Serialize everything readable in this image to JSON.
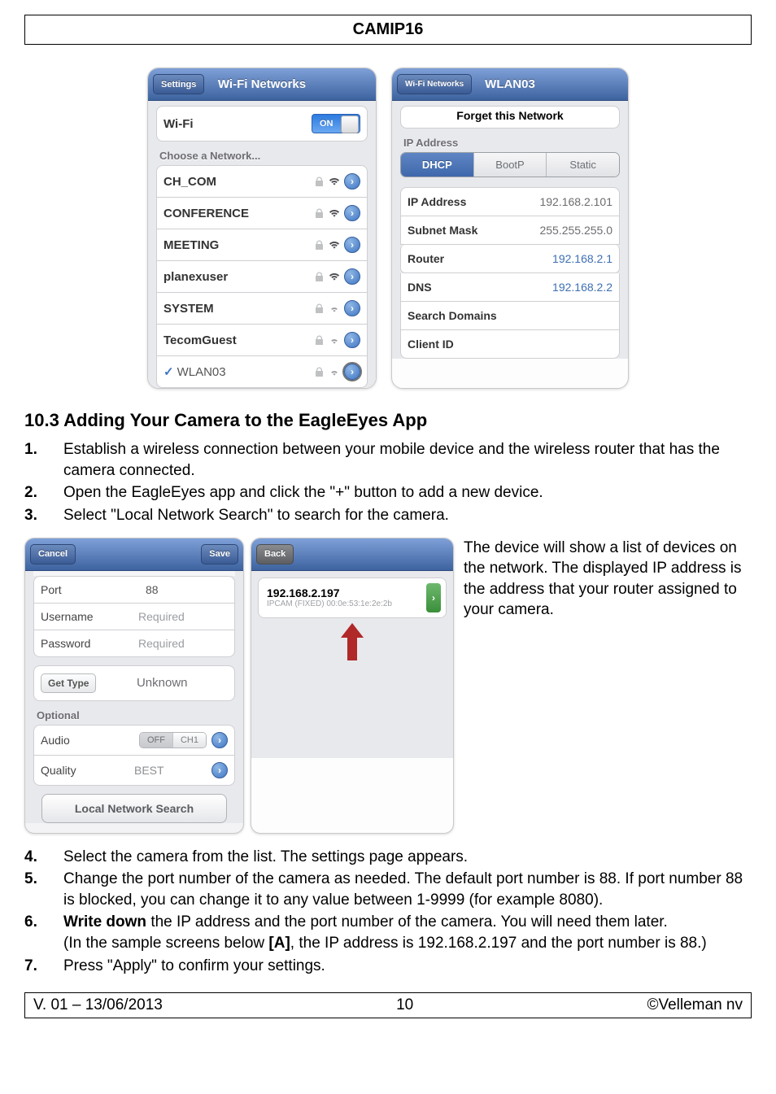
{
  "header": {
    "product": "CAMIP16"
  },
  "wifi_panel": {
    "nav_back": "Settings",
    "nav_title": "Wi-Fi Networks",
    "wifi_label": "Wi-Fi",
    "toggle": "ON",
    "choose": "Choose a Network...",
    "networks": [
      {
        "name": "CH_COM",
        "selected": false
      },
      {
        "name": "CONFERENCE",
        "selected": false
      },
      {
        "name": "MEETING",
        "selected": false
      },
      {
        "name": "planexuser",
        "selected": false
      },
      {
        "name": "SYSTEM",
        "selected": false
      },
      {
        "name": "TecomGuest",
        "selected": false
      },
      {
        "name": "WLAN03",
        "selected": true
      }
    ]
  },
  "wlan_panel": {
    "nav_back": "Wi-Fi Networks",
    "nav_title": "WLAN03",
    "forget": "Forget this Network",
    "ipaddress_head": "IP Address",
    "tabs": {
      "dhcp": "DHCP",
      "bootp": "BootP",
      "static": "Static"
    },
    "kv": {
      "ip_label": "IP Address",
      "ip_val": "192.168.2.101",
      "mask_label": "Subnet Mask",
      "mask_val": "255.255.255.0",
      "router_label": "Router",
      "router_val": "192.168.2.1",
      "dns_label": "DNS",
      "dns_val": "192.168.2.2",
      "search_label": "Search Domains",
      "client_label": "Client ID"
    }
  },
  "section_10_3": {
    "heading": "10.3   Adding Your Camera to the EagleEyes App",
    "steps_a": [
      "Establish a wireless connection between your mobile device and the wireless router that has the camera connected.",
      "Open the EagleEyes app and click the \"+\" button to add a new device.",
      "Select \"Local Network Search\" to search for the camera."
    ],
    "side_text": "The device will show a list of devices on the network. The displayed IP address is the address that your router assigned to your camera.",
    "steps_b": {
      "4": "Select the camera from the list. The settings page appears.",
      "5": "Change the port number of the camera as needed. The default port number is 88. If port number 88 is blocked, you can change it to any value between 1-9999 (for example 8080).",
      "6a": "Write down",
      "6b": " the IP address and the port number of the camera. You will need them later.",
      "6c": "(In the sample screens below ",
      "6d": "[A]",
      "6e": ", the IP address is 192.168.2.197 and the port number is 88.)",
      "7": "Press \"Apply\" to confirm your settings."
    }
  },
  "device_card": {
    "cancel": "Cancel",
    "save": "Save",
    "port_label": "Port",
    "port_val": "88",
    "user_label": "Username",
    "user_ph": "Required",
    "pass_label": "Password",
    "pass_ph": "Required",
    "gettype_btn": "Get Type",
    "gettype_val": "Unknown",
    "optional": "Optional",
    "audio_label": "Audio",
    "audio_off": "OFF",
    "audio_ch1": "CH1",
    "quality_label": "Quality",
    "quality_val": "BEST",
    "lns": "Local Network Search"
  },
  "back_card": {
    "back": "Back",
    "ip": "192.168.2.197",
    "sub": "IPCAM (FIXED)  00:0e:53:1e:2e:2b"
  },
  "footer": {
    "left": "V. 01 – 13/06/2013",
    "center": "10",
    "right": "©Velleman nv"
  }
}
